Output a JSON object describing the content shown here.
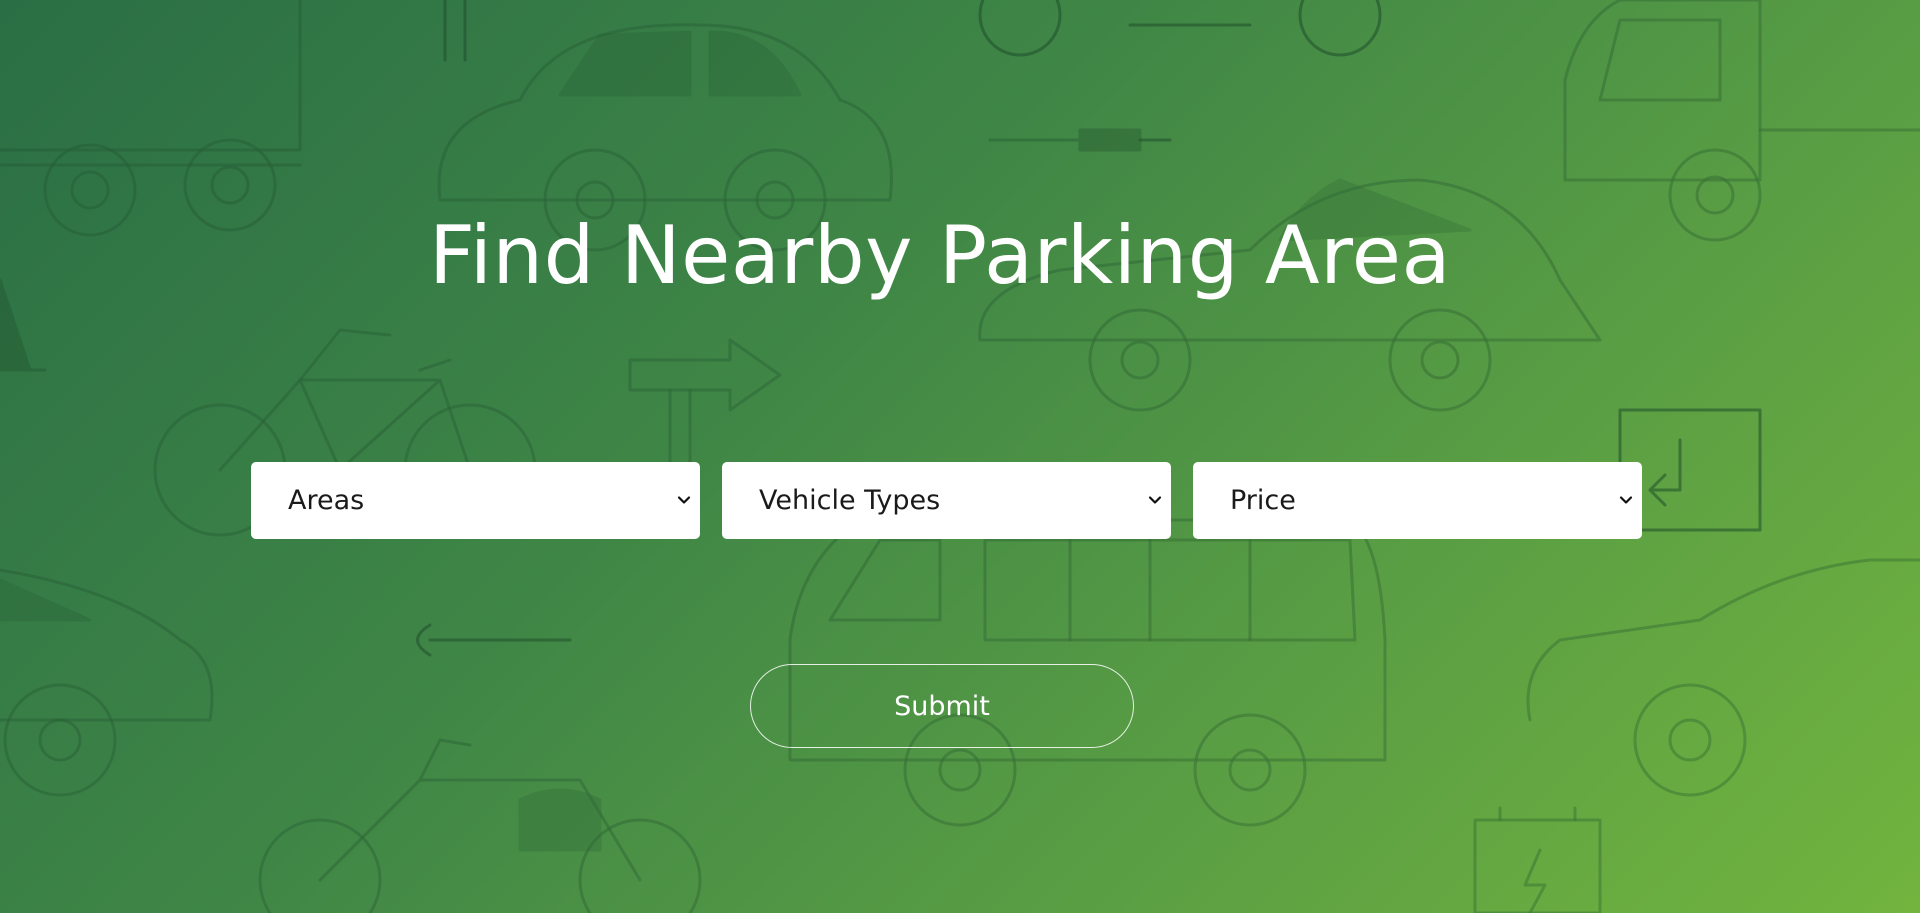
{
  "hero": {
    "title": "Find Nearby Parking Area",
    "background_gradient": [
      "#2a6e45",
      "#72b43e"
    ]
  },
  "filters": {
    "areas": {
      "selected": "Areas",
      "icon": "chevron-down-icon"
    },
    "vehicle_types": {
      "selected": "Vehicle Types",
      "icon": "chevron-down-icon"
    },
    "price": {
      "selected": "Price",
      "icon": "chevron-down-icon"
    }
  },
  "actions": {
    "submit_label": "Submit"
  }
}
